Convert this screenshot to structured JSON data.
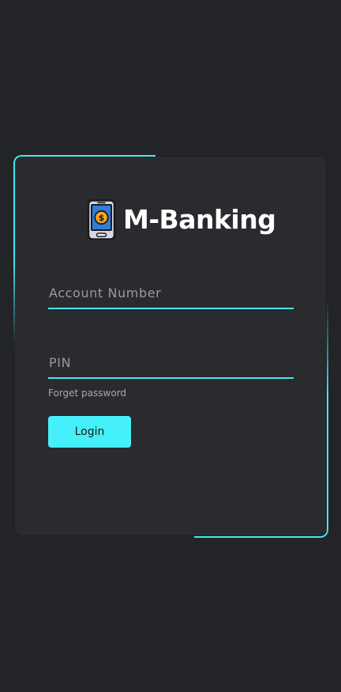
{
  "app": {
    "title": "M-Banking",
    "logo_icon": "mobile-dollar-icon"
  },
  "form": {
    "account_number": {
      "placeholder": "Account Number",
      "value": ""
    },
    "pin": {
      "placeholder": "PIN",
      "value": ""
    },
    "forgot_label": "Forget password",
    "login_label": "Login"
  },
  "colors": {
    "background": "#232428",
    "card": "#2a2b2f",
    "accent": "#45e7f2",
    "button": "#45f0fa",
    "text": "#ffffff",
    "muted": "#9a9a9e"
  }
}
